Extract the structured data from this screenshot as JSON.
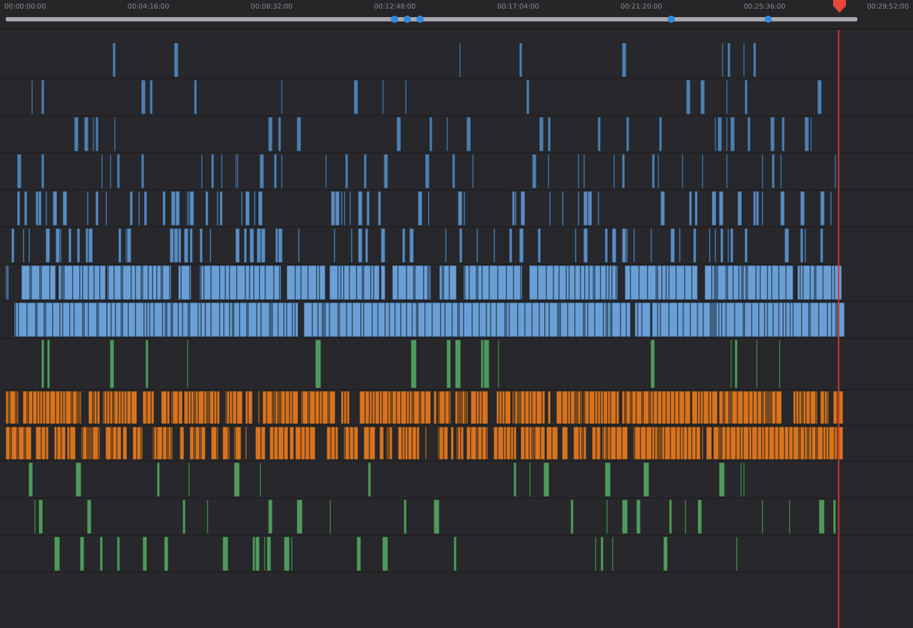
{
  "ruler": {
    "timecodes": [
      "00:00:00:00",
      "00:04:16:00",
      "00:08:32:00",
      "00:12:48:00",
      "00:17:04:00",
      "00:21:20:00",
      "00:25:36:00",
      "00:29:52:00"
    ],
    "markers": [
      {
        "color": "#2f8ae0"
      },
      {
        "color": "#2f8ae0"
      },
      {
        "color": "#2f8ae0"
      },
      {
        "color": "#2f8ae0"
      },
      {
        "color": "#2f8ae0"
      }
    ],
    "playhead": {
      "level": 0.978
    }
  },
  "tracks": [
    {
      "kind": "video",
      "color": "#4f7fae"
    },
    {
      "kind": "video",
      "color": "#4f7fae"
    },
    {
      "kind": "video",
      "color": "#4f7fae"
    },
    {
      "kind": "video",
      "color": "#4f7fae"
    },
    {
      "kind": "video",
      "color": "#5a8cc0"
    },
    {
      "kind": "video",
      "color": "#5a8cc0"
    },
    {
      "kind": "video",
      "color": "#6a9fd6"
    },
    {
      "kind": "video",
      "color": "#6a9fd6"
    },
    {
      "kind": "audio",
      "color": "#4f9a5e"
    },
    {
      "kind": "audio",
      "color": "#d9731f"
    },
    {
      "kind": "audio",
      "color": "#d9731f"
    },
    {
      "kind": "audio",
      "color": "#4f9a5e"
    },
    {
      "kind": "audio",
      "color": "#4f9a5e"
    },
    {
      "kind": "audio",
      "color": "#4f9a5e"
    }
  ]
}
